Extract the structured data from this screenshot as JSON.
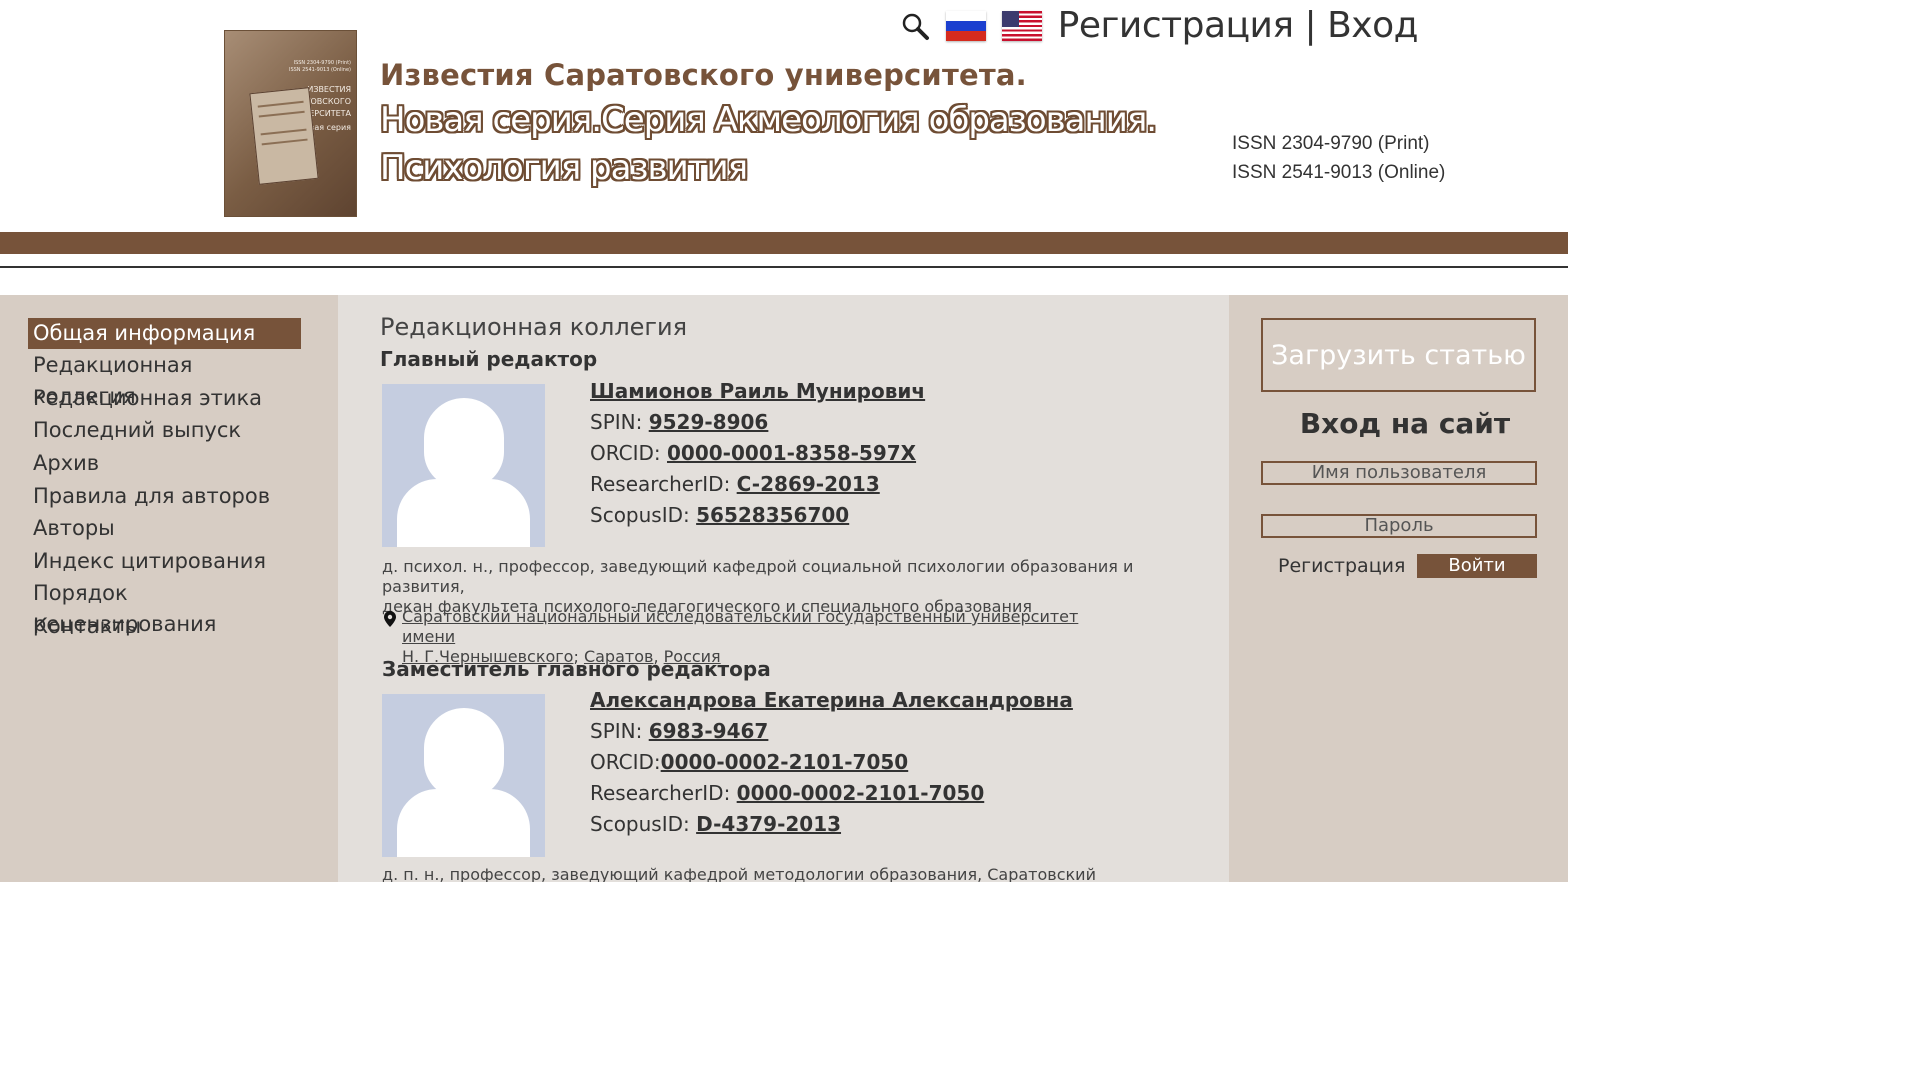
{
  "header": {
    "cover_text": [
      "ISSN 2304-9790 (Print)",
      "ISSN 2541-9013 (Online)",
      "ИЗВЕСТИЯ",
      "САРАТОВСКОГО",
      "УНИВЕРСИТЕТА",
      "Новая серия"
    ],
    "title_line1": "Известия Саратовского университета.",
    "title_line2": "Новая серия.Серия Акмеология образования.",
    "title_line3": "Психология развития",
    "issn_print": "ISSN 2304-9790 (Print)",
    "issn_online": "ISSN 2541-9013 (Online)",
    "auth_text": "Регистрация | Вход"
  },
  "sidebar": {
    "items": [
      {
        "label": "Общая информация"
      },
      {
        "label": "Редакционная коллегия"
      },
      {
        "label": "Редакционная этика"
      },
      {
        "label": "Последний выпуск"
      },
      {
        "label": "Архив"
      },
      {
        "label": "Правила для авторов"
      },
      {
        "label": "Авторы"
      },
      {
        "label": "Индекс цитирования"
      },
      {
        "label": "Порядок рецензирования"
      },
      {
        "label": "Контакты"
      }
    ]
  },
  "main": {
    "page_title": "Редакционная коллегия",
    "chief": {
      "role": "Главный редактор",
      "name": "Шамионов Раиль Мунирович",
      "spin_label": "SPIN:",
      "spin": "9529-8906",
      "orcid_label": "ORCID:",
      "orcid": "0000-0001-8358-597X",
      "rid_label": "ResearcherID:",
      "rid": "C-2869-2013",
      "scopus_label": "ScopusID:",
      "scopus": "56528356700",
      "desc_line1": "д. психол. н., профессор, заведующий кафедрой социальной психологии образования и развития,",
      "desc_line2": "декан факультета психолого-педагогического и специального образования",
      "aff_org_line1": "Саратовский национальный исследовательский государственный университет имени ",
      "aff_org_line2": "Н. Г.Чернышевского",
      "aff_sep1": ";",
      "aff_city": "Саратов",
      "aff_sep2": ",",
      "aff_country": "Россия"
    },
    "deputy": {
      "role": "Заместитель  главного редактора",
      "name": "Александрова Екатерина Александровна",
      "spin_label": "SPIN:",
      "spin": "6983-9467",
      "orcid_label": "ORCID:",
      "orcid": "0000-0002-2101-7050",
      "rid_label": "ResearcherID:",
      "rid": "0000-0002-2101-7050",
      "scopus_label": "ScopusID:",
      "scopus": "D-4379-2013",
      "desc_line1": "д. п. н., профессор, заведующий кафедрой  методологии образования, Саратовский национальный"
    }
  },
  "right": {
    "upload_label": "Загрузить статью",
    "login_title": "Вход на сайт",
    "username_placeholder": "Имя пользователя",
    "password_placeholder": "Пароль",
    "register_label": "Регистрация",
    "login_button": "Войти"
  },
  "colors": {
    "brand_brown": "#77533a",
    "sidebar_bg": "#d7cdc4",
    "content_bg": "#e3dfdb"
  },
  "icons": [
    "search-icon",
    "russian-flag-icon",
    "us-flag-icon",
    "location-pin-icon",
    "avatar-placeholder"
  ]
}
